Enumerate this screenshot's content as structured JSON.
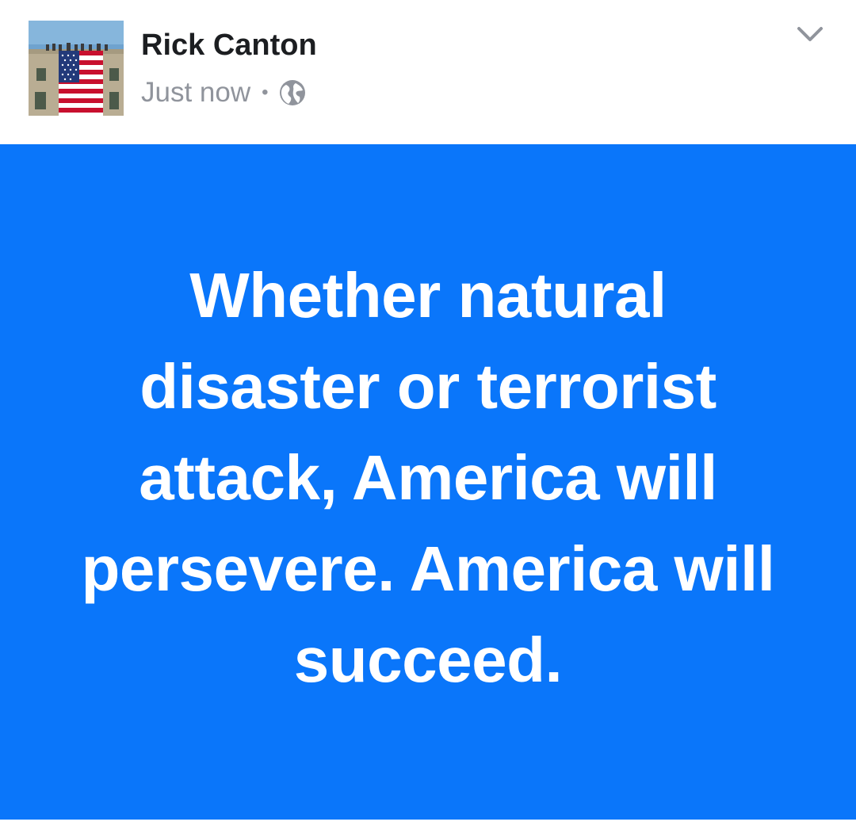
{
  "post": {
    "author": "Rick Canton",
    "timestamp": "Just now",
    "separator": "•",
    "privacy_icon": "globe-icon",
    "menu_icon": "chevron-down-icon",
    "avatar_description_icon": "avatar",
    "text_card": {
      "text": "Whether natural disaster or terrorist attack, America will persevere. America will succeed.",
      "background_color": "#0a76fa",
      "text_color": "#ffffff"
    }
  },
  "colors": {
    "author": "#1c1e21",
    "meta": "#90949c"
  }
}
